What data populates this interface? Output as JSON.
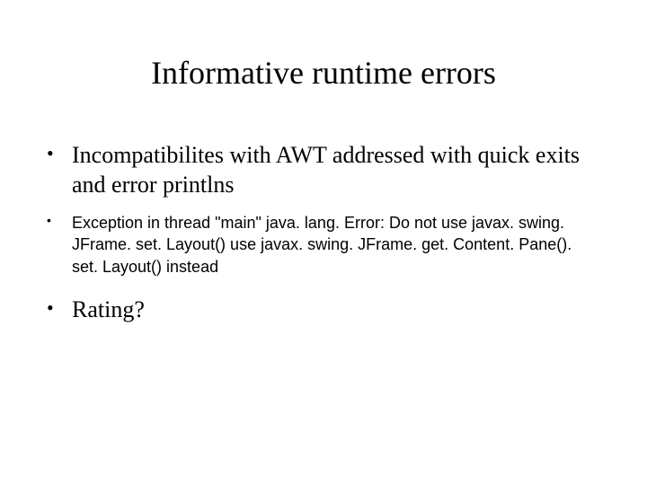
{
  "title": "Informative runtime errors",
  "bullets": {
    "item1": "Incompatibilites with AWT addressed with quick exits and error printlns",
    "item2": "Exception in thread \"main\" java. lang. Error: Do not use javax. swing. JFrame. set. Layout() use javax. swing. JFrame. get. Content. Pane(). set. Layout() instead",
    "item3": "Rating?"
  }
}
